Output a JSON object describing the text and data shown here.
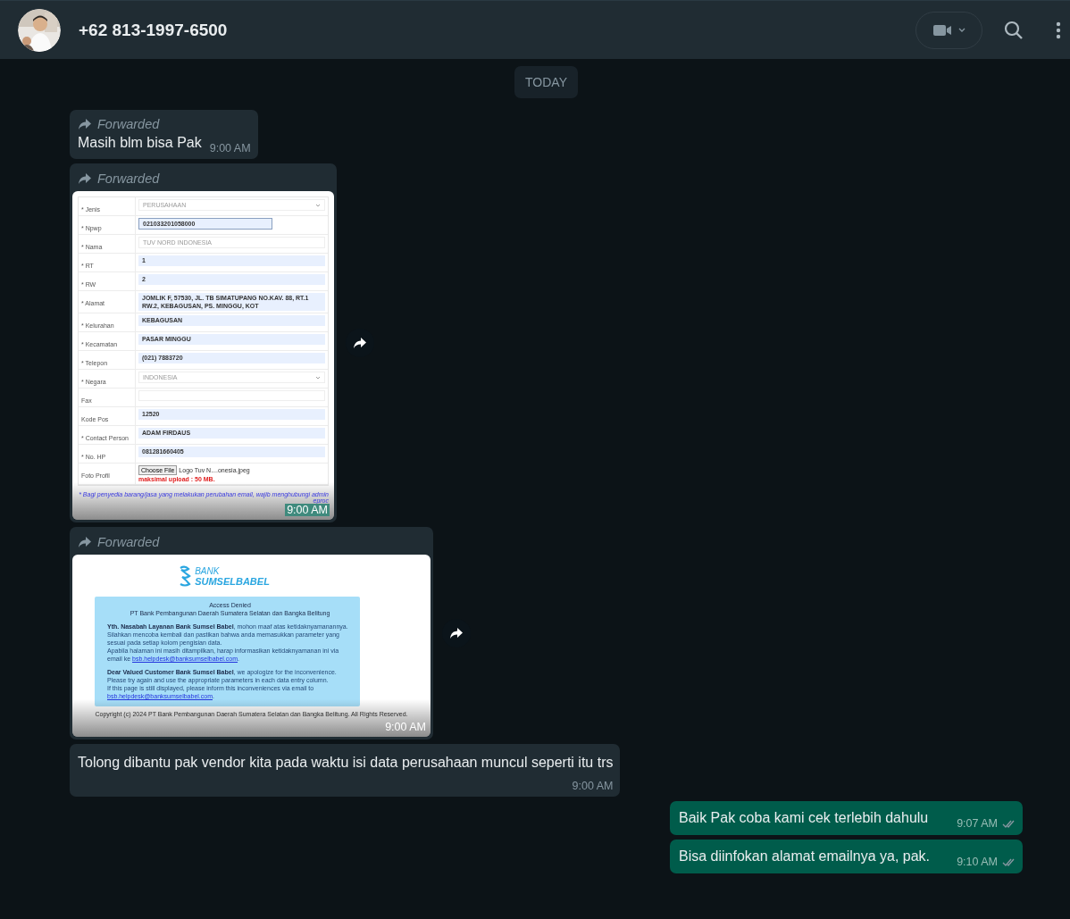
{
  "header": {
    "contact": "+62 813-1997-6500"
  },
  "date_chip": "TODAY",
  "messages": [
    {
      "kind": "text",
      "outgoing": false,
      "forwarded_label": "Forwarded",
      "text": "Masih blm bisa Pak",
      "time": "9:00 AM"
    },
    {
      "kind": "form_image",
      "outgoing": false,
      "forwarded_label": "Forwarded",
      "time": "9:00 AM",
      "form": {
        "rows": [
          {
            "kind": "select",
            "label": "* Jenis",
            "value": "PERUSAHAAN"
          },
          {
            "kind": "focused",
            "label": "* Npwp",
            "value": "021033201058000"
          },
          {
            "kind": "plain",
            "label": "* Nama",
            "value": "TUV NORD INDONESIA"
          },
          {
            "kind": "filled",
            "label": "* RT",
            "value": "1"
          },
          {
            "kind": "filled",
            "label": "* RW",
            "value": "2"
          },
          {
            "kind": "filled",
            "label": "* Alamat",
            "value": "JOMLIK F, 57530, JL. TB SIMATUPANG NO.KAV. 88, RT.1 RW.2, KEBAGUSAN, PS. MINGGU, KOT"
          },
          {
            "kind": "filled",
            "label": "* Kelurahan",
            "value": "KEBAGUSAN"
          },
          {
            "kind": "filled",
            "label": "* Kecamatan",
            "value": "PASAR MINGGU"
          },
          {
            "kind": "filled",
            "label": "* Telepon",
            "value": "(021) 7883720"
          },
          {
            "kind": "select",
            "label": "* Negara",
            "value": "INDONESIA"
          },
          {
            "kind": "empty",
            "label": "Fax"
          },
          {
            "kind": "filled",
            "label": "Kode Pos",
            "value": "12520"
          },
          {
            "kind": "filled",
            "label": "* Contact Person",
            "value": "ADAM FIRDAUS"
          },
          {
            "kind": "filled",
            "label": "* No. HP",
            "value": "081281660405"
          },
          {
            "kind": "file",
            "label": "Foto Profil",
            "button": "Choose File",
            "value": "Logo Tuv N....onesia.jpeg",
            "hint": "maksimal upload : 50 MB."
          }
        ],
        "note": "* Bagi penyedia barang/jasa yang melakukan perubahan email, wajib menghubungi admin eproc"
      }
    },
    {
      "kind": "error_image",
      "outgoing": false,
      "forwarded_label": "Forwarded",
      "time": "9:00 AM",
      "page": {
        "logo_top": "BANK",
        "logo_bottom": "SUMSELBABEL",
        "title": "Access Denied",
        "subtitle": "PT Bank Pembangunan Daerah Sumatera Selatan dan Bangka Belitung",
        "paragraphs": [
          {
            "sentences": [
              "**Yth. Nasabah Layanan Bank Sumsel Babel**, mohon maaf atas ketidaknyamanannya.",
              "Silahkan mencoba kembali dan pastikan bahwa anda memasukkan parameter yang sesuai pada setiap kolom pengisian data.",
              "Apabila halaman ini masih ditampilkan, harap informasikan ketidaknyamanan ini via email ke"
            ],
            "email": "bsb.helpdesk@banksumselbabel.com",
            "after": "."
          },
          {
            "sentences": [
              "**Dear Valued Customer Bank Sumsel Babel**, we apologize for the inconvenience.",
              "Please try again and use the appropriate parameters in each data entry column.",
              "If this page is still displayed, please inform this inconveniences via email to"
            ],
            "email": "bsb.helpdesk@banksumselbabel.com",
            "after": "."
          }
        ],
        "copyright": "Copyright (c) 2024 PT Bank Pembangunan Daerah Sumatera Selatan dan Bangka Belitung. All Rights Reserved."
      }
    },
    {
      "kind": "text",
      "outgoing": false,
      "text": "Tolong dibantu pak vendor kita pada waktu isi data perusahaan muncul seperti itu trs",
      "time": "9:00 AM"
    },
    {
      "kind": "text",
      "outgoing": true,
      "text": "Baik Pak coba kami cek terlebih dahulu",
      "time": "9:07 AM",
      "read": false
    },
    {
      "kind": "text",
      "outgoing": true,
      "text": "Bisa diinfokan alamat emailnya ya, pak.",
      "time": "9:10 AM",
      "read": false
    }
  ]
}
